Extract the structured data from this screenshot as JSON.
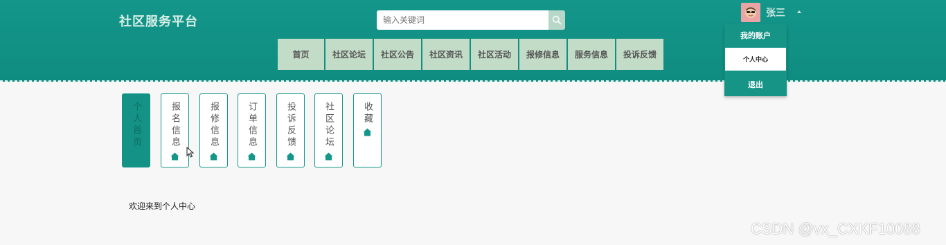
{
  "header": {
    "brand": "社区服务平台",
    "search": {
      "placeholder": "输入关键词",
      "value": ""
    },
    "nav": [
      "首页",
      "社区论坛",
      "社区公告",
      "社区资讯",
      "社区活动",
      "报修信息",
      "服务信息",
      "投诉反馈"
    ],
    "user": {
      "name": "张三"
    }
  },
  "dropdown": {
    "title": "我的账户",
    "center": "个人中心",
    "logout": "退出"
  },
  "sidebar": {
    "items": [
      {
        "label": "个人首页",
        "active": true
      },
      {
        "label": "报名信息",
        "active": false
      },
      {
        "label": "报修信息",
        "active": false
      },
      {
        "label": "订单信息",
        "active": false
      },
      {
        "label": "投诉反馈",
        "active": false
      },
      {
        "label": "社区论坛",
        "active": false
      },
      {
        "label": "收藏",
        "active": false
      }
    ]
  },
  "main": {
    "welcome": "欢迎来到个人中心"
  },
  "watermark": "CSDN @vx_CXKF10088",
  "colors": {
    "primary": "#14968a",
    "nav_bg": "#c3dcc8",
    "background": "#f7f7f7"
  },
  "icons": {
    "search": "search-icon",
    "tab": "home-icon",
    "avatar": "avatar-icon"
  }
}
